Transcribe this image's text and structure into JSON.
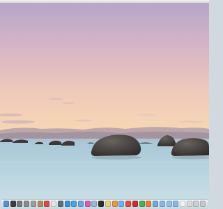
{
  "colors": {
    "sky_top": "#b9a9c9",
    "sky_mid": "#e9c5bb",
    "horizon_glow": "#f6d7b3",
    "water_far": "#a8c8d6",
    "water_near": "#c9dfe6",
    "rock": "#4b4644"
  },
  "dock": {
    "icons": [
      {
        "name": "finder-icon",
        "color": "#5a8fd8"
      },
      {
        "name": "dashboard-icon",
        "color": "#3e3e3e"
      },
      {
        "name": "mission-control-icon",
        "color": "#7a7a7a"
      },
      {
        "name": "system-preferences-icon",
        "color": "#8a8a8a"
      },
      {
        "name": "photo-booth-icon",
        "color": "#9d9d9d"
      },
      {
        "name": "contacts-icon",
        "color": "#b5895d"
      },
      {
        "name": "calendar-icon",
        "color": "#d84b47"
      },
      {
        "name": "photos-icon",
        "color": "#e4e4e4"
      },
      {
        "name": "time-machine-icon",
        "color": "#5b6f7f"
      },
      {
        "name": "app-store-icon",
        "color": "#3d8de0"
      },
      {
        "name": "safari-icon",
        "color": "#4aa3e6"
      },
      {
        "name": "mail-icon",
        "color": "#6aa5e7"
      },
      {
        "name": "itunes-icon",
        "color": "#d060b4"
      },
      {
        "name": "preview-icon",
        "color": "#9bb8d7"
      },
      {
        "name": "terminal-icon",
        "color": "#2f2f2f"
      },
      {
        "name": "notes-icon",
        "color": "#e9d27b"
      },
      {
        "name": "ibooks-icon",
        "color": "#e69a38"
      },
      {
        "name": "messages-icon",
        "color": "#67b3ef"
      },
      {
        "name": "chrome-icon",
        "color": "#e8473c"
      },
      {
        "name": "opera-icon",
        "color": "#d12a2a"
      },
      {
        "name": "maps-icon",
        "color": "#4caf50"
      },
      {
        "name": "sublime-text-icon",
        "color": "#f07d2d"
      },
      {
        "name": "textedit-icon",
        "color": "#6fa9d8"
      },
      {
        "name": "folder-icon",
        "color": "#86b8e4"
      },
      {
        "name": "downloads-folder-icon",
        "color": "#8fc0ea"
      },
      {
        "name": "documents-folder-icon",
        "color": "#86b8e4"
      },
      {
        "name": "document-stack-icon",
        "color": "#f2f2f2"
      },
      {
        "name": "image-stack-icon",
        "color": "#d9d9d9"
      },
      {
        "name": "archive-stack-icon",
        "color": "#cfcfcf"
      },
      {
        "name": "trash-icon",
        "color": "#c9c9c9"
      }
    ]
  }
}
